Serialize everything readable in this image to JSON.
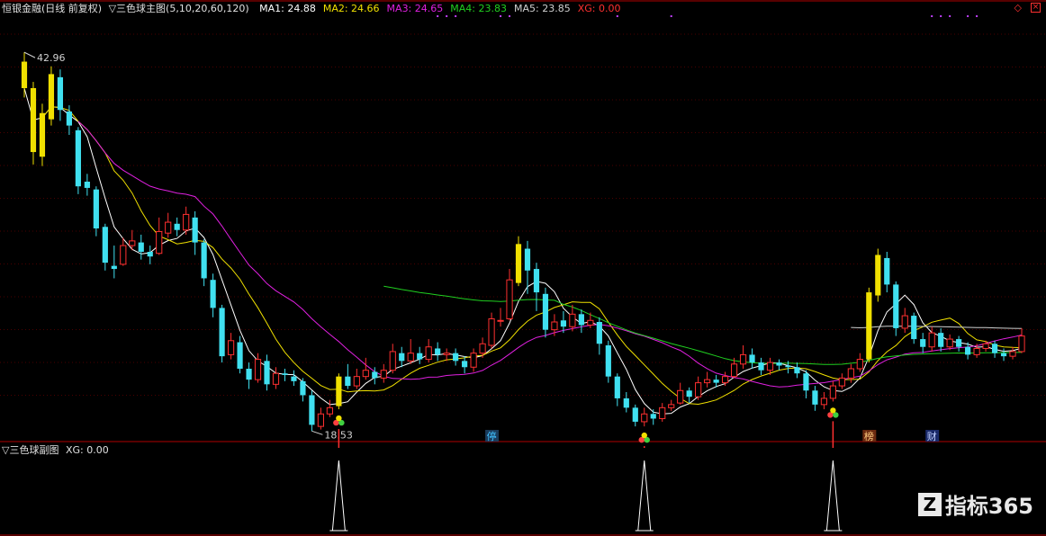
{
  "header": {
    "stock_name": "恒银金融(日线 前复权)",
    "indicator": "▽三色球主图(5,10,20,60,120)",
    "ma": [
      {
        "label": "MA1: 24.88",
        "color": "#ffffff"
      },
      {
        "label": "MA2: 24.66",
        "color": "#f0e000"
      },
      {
        "label": "MA3: 24.65",
        "color": "#e020e0"
      },
      {
        "label": "MA4: 23.83",
        "color": "#20d020"
      },
      {
        "label": "MA5: 23.85",
        "color": "#d0d0d0"
      },
      {
        "label": "XG: 0.00",
        "color": "#ff3030"
      }
    ]
  },
  "sub_header": {
    "title": "▽三色球副图",
    "xg": "XG: 0.00"
  },
  "markers": {
    "high_label": "42.96",
    "low_label": "18.53",
    "events": [
      {
        "text": "停",
        "bg": "#1a3a5a",
        "fg": "#40c0ff"
      },
      {
        "text": "榜",
        "bg": "#6a2a10",
        "fg": "#ffcc80"
      },
      {
        "text": "财",
        "bg": "#1a2a6a",
        "fg": "#c0d0ff"
      }
    ]
  },
  "watermark": {
    "icon": "Z",
    "text": "指标365"
  },
  "icons": {
    "restore": "diamond-outline-icon",
    "close": "close-square-icon"
  },
  "colors": {
    "up": "#ff3030",
    "down": "#40e0f0",
    "signal": "#f0e000",
    "grid": "#4a0000",
    "divider": "#b00000"
  },
  "chart_data": {
    "type": "candlestick",
    "price_range": [
      17,
      44
    ],
    "candles": [
      [
        41.2,
        39.5,
        41.8,
        38.9
      ],
      [
        39.5,
        35.4,
        39.9,
        34.6
      ],
      [
        35.1,
        37.9,
        38.5,
        34.5
      ],
      [
        37.5,
        40.4,
        40.9,
        37.1
      ],
      [
        40.2,
        38.1,
        40.7,
        37.4
      ],
      [
        38.0,
        37.1,
        38.4,
        36.5
      ],
      [
        36.8,
        33.2,
        37.0,
        32.7
      ],
      [
        33.5,
        33.1,
        34.0,
        32.6
      ],
      [
        33.0,
        30.5,
        33.2,
        30.0
      ],
      [
        30.6,
        28.3,
        30.8,
        27.8
      ],
      [
        28.1,
        27.9,
        29.4,
        27.3
      ],
      [
        28.2,
        29.4,
        29.9,
        28.1
      ],
      [
        29.4,
        29.7,
        30.4,
        29.1
      ],
      [
        29.6,
        29.0,
        30.1,
        28.5
      ],
      [
        29.0,
        28.7,
        29.4,
        28.2
      ],
      [
        28.9,
        30.3,
        31.2,
        28.8
      ],
      [
        30.2,
        30.9,
        31.5,
        29.9
      ],
      [
        30.8,
        30.4,
        31.2,
        30.0
      ],
      [
        30.4,
        31.4,
        31.9,
        30.1
      ],
      [
        31.2,
        29.6,
        31.6,
        28.8
      ],
      [
        29.6,
        27.3,
        29.8,
        26.8
      ],
      [
        27.2,
        25.4,
        27.6,
        24.8
      ],
      [
        25.4,
        22.3,
        25.6,
        21.9
      ],
      [
        22.4,
        23.3,
        23.8,
        22.1
      ],
      [
        23.2,
        21.5,
        23.6,
        21.2
      ],
      [
        21.5,
        20.8,
        21.9,
        20.2
      ],
      [
        20.8,
        22.1,
        22.5,
        20.6
      ],
      [
        22.0,
        20.5,
        22.4,
        20.1
      ],
      [
        20.5,
        21.2,
        21.6,
        20.2
      ],
      [
        21.2,
        21.1,
        21.5,
        20.7
      ],
      [
        21.0,
        20.7,
        21.4,
        20.4
      ],
      [
        20.7,
        19.8,
        20.9,
        19.4
      ],
      [
        19.8,
        17.9,
        20.1,
        17.5
      ],
      [
        17.8,
        18.6,
        19.0,
        17.6
      ],
      [
        18.6,
        19.0,
        19.5,
        18.4
      ],
      [
        19.1,
        21.0,
        21.2,
        18.9
      ],
      [
        21.0,
        20.4,
        21.8,
        20.2
      ],
      [
        20.4,
        21.0,
        21.5,
        20.2
      ],
      [
        21.0,
        21.4,
        22.2,
        20.8
      ],
      [
        21.3,
        20.9,
        21.6,
        20.5
      ],
      [
        20.9,
        21.4,
        21.8,
        20.6
      ],
      [
        21.4,
        22.6,
        23.1,
        21.2
      ],
      [
        22.5,
        22.0,
        22.9,
        21.6
      ],
      [
        22.0,
        22.5,
        23.4,
        21.8
      ],
      [
        22.5,
        22.1,
        22.9,
        21.8
      ],
      [
        22.1,
        22.9,
        23.4,
        21.9
      ],
      [
        22.8,
        22.4,
        23.2,
        22.0
      ],
      [
        22.4,
        22.5,
        22.8,
        22.0
      ],
      [
        22.5,
        22.0,
        22.8,
        21.7
      ],
      [
        22.0,
        21.6,
        22.3,
        21.2
      ],
      [
        21.6,
        22.5,
        22.8,
        21.3
      ],
      [
        22.5,
        23.1,
        23.5,
        22.2
      ],
      [
        23.0,
        24.7,
        25.1,
        22.8
      ],
      [
        24.6,
        24.6,
        25.4,
        24.2
      ],
      [
        24.7,
        27.2,
        27.9,
        24.6
      ],
      [
        27.0,
        29.5,
        30.0,
        26.8
      ],
      [
        29.2,
        27.8,
        29.7,
        26.3
      ],
      [
        27.9,
        26.4,
        28.3,
        25.2
      ],
      [
        26.3,
        24.0,
        26.7,
        23.5
      ],
      [
        24.0,
        24.5,
        25.0,
        23.6
      ],
      [
        24.6,
        24.2,
        25.2,
        23.8
      ],
      [
        24.2,
        25.0,
        25.6,
        23.9
      ],
      [
        25.0,
        24.3,
        25.3,
        23.8
      ],
      [
        24.3,
        24.6,
        25.1,
        24.1
      ],
      [
        24.5,
        23.1,
        24.8,
        22.4
      ],
      [
        23.0,
        21.0,
        23.3,
        20.6
      ],
      [
        21.0,
        19.6,
        21.2,
        19.1
      ],
      [
        19.6,
        19.0,
        20.0,
        18.7
      ],
      [
        19.0,
        18.1,
        19.2,
        17.8
      ],
      [
        18.1,
        18.6,
        19.0,
        17.8
      ],
      [
        18.6,
        18.3,
        18.9,
        17.9
      ],
      [
        18.3,
        19.0,
        19.3,
        18.1
      ],
      [
        19.0,
        19.2,
        19.5,
        18.8
      ],
      [
        19.3,
        20.1,
        20.6,
        19.2
      ],
      [
        20.1,
        19.7,
        20.3,
        19.3
      ],
      [
        19.7,
        20.6,
        21.0,
        19.5
      ],
      [
        20.6,
        20.8,
        21.3,
        20.3
      ],
      [
        20.8,
        20.6,
        21.1,
        20.3
      ],
      [
        20.6,
        21.0,
        21.3,
        20.4
      ],
      [
        21.0,
        21.8,
        22.2,
        20.9
      ],
      [
        21.8,
        22.4,
        23.0,
        21.5
      ],
      [
        22.4,
        21.9,
        22.8,
        21.5
      ],
      [
        21.9,
        21.4,
        22.2,
        21.1
      ],
      [
        21.4,
        21.9,
        22.2,
        21.1
      ],
      [
        21.9,
        21.7,
        22.1,
        21.4
      ],
      [
        21.7,
        21.6,
        22.0,
        21.2
      ],
      [
        21.6,
        21.2,
        21.9,
        20.9
      ],
      [
        21.2,
        20.1,
        21.4,
        19.6
      ],
      [
        20.1,
        19.2,
        20.4,
        18.8
      ],
      [
        19.2,
        19.6,
        20.0,
        18.9
      ],
      [
        19.6,
        20.4,
        20.7,
        19.4
      ],
      [
        20.4,
        20.9,
        21.2,
        20.2
      ],
      [
        20.9,
        21.5,
        21.8,
        20.6
      ],
      [
        21.5,
        22.1,
        22.5,
        21.3
      ],
      [
        22.1,
        26.4,
        26.7,
        21.9
      ],
      [
        26.2,
        28.8,
        29.2,
        25.8
      ],
      [
        28.6,
        26.9,
        29.0,
        26.4
      ],
      [
        26.9,
        24.1,
        27.1,
        23.6
      ],
      [
        24.1,
        24.9,
        25.4,
        23.8
      ],
      [
        24.9,
        23.4,
        25.1,
        23.1
      ],
      [
        23.4,
        22.9,
        23.8,
        22.5
      ],
      [
        22.9,
        23.8,
        24.2,
        22.6
      ],
      [
        23.8,
        22.9,
        24.1,
        22.6
      ],
      [
        22.9,
        23.4,
        23.7,
        22.7
      ],
      [
        23.4,
        22.9,
        23.6,
        22.6
      ],
      [
        22.9,
        22.4,
        23.2,
        22.1
      ],
      [
        22.4,
        22.8,
        23.1,
        22.2
      ],
      [
        22.8,
        23.1,
        23.3,
        22.6
      ],
      [
        23.1,
        22.5,
        23.3,
        22.2
      ],
      [
        22.5,
        22.3,
        22.8,
        22.0
      ],
      [
        22.3,
        22.6,
        22.9,
        22.1
      ],
      [
        22.6,
        23.6,
        24.1,
        22.5
      ]
    ],
    "signal_bars": [
      0,
      1,
      2,
      3,
      35,
      55,
      94,
      95
    ],
    "xg_signals": [
      35,
      69,
      90
    ]
  }
}
